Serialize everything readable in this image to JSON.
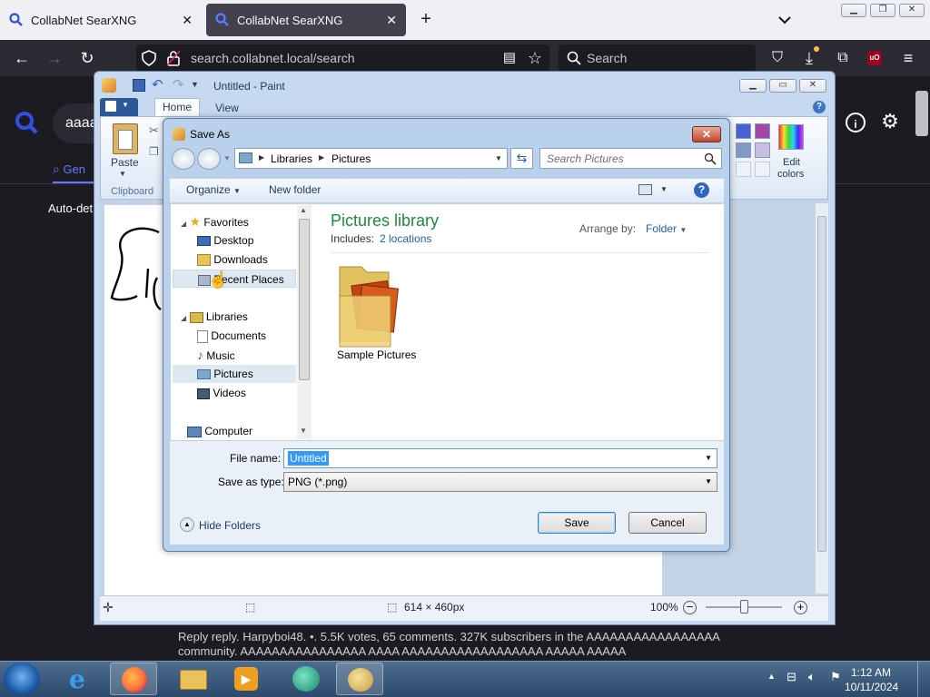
{
  "browser": {
    "tabs": [
      {
        "label": "CollabNet SearXNG",
        "active": false
      },
      {
        "label": "CollabNet SearXNG",
        "active": true
      }
    ],
    "url": "search.collabnet.local/search",
    "search_placeholder": "Search"
  },
  "page": {
    "query_partial": "aaaa",
    "general_tab": "Gen",
    "auto_detect": "Auto-det",
    "reply_line1": "Reply reply. Harpyboi48. •. 5.5K votes, 65 comments. 327K subscribers in the AAAAAAAAAAAAAAAAA",
    "reply_line2": "community. AAAAAAAAAAAAAAAA AAAA AAAAAAAAAAAAAAAAAA AAAAA AAAAA"
  },
  "paint": {
    "title": "Untitled - Paint",
    "tabs": {
      "home": "Home",
      "view": "View"
    },
    "paste_label": "Paste",
    "clipboard_label": "Clipboard",
    "edit_colors_line1": "Edit",
    "edit_colors_line2": "colors",
    "status_size": "614 × 460px",
    "zoom": "100%"
  },
  "dialog": {
    "title": "Save As",
    "breadcrumb": [
      "Libraries",
      "Pictures"
    ],
    "search_placeholder": "Search Pictures",
    "organize_label": "Organize",
    "new_folder_label": "New folder",
    "nav": {
      "favorites": "Favorites",
      "desktop": "Desktop",
      "downloads": "Downloads",
      "recent": "Recent Places",
      "libraries": "Libraries",
      "documents": "Documents",
      "music": "Music",
      "pictures": "Pictures",
      "videos": "Videos",
      "computer": "Computer"
    },
    "library_title": "Pictures library",
    "includes_label": "Includes:",
    "includes_link": "2 locations",
    "arrange_label": "Arrange by:",
    "arrange_value": "Folder",
    "folder_item": "Sample Pictures",
    "file_name_label": "File name:",
    "file_name_value": "Untitled",
    "save_type_label": "Save as type:",
    "save_type_value": "PNG (*.png)",
    "hide_folders": "Hide Folders",
    "save_button": "Save",
    "cancel_button": "Cancel"
  },
  "taskbar": {
    "time": "1:12 AM",
    "date": "10/11/2024"
  },
  "colors": {
    "browser_dark": "#1c1b22",
    "paint_frame": "#c6d9f0",
    "dialog_frame": "#b9d1ea",
    "selection_blue": "#3399ff",
    "library_title": "#1e8a3c"
  }
}
